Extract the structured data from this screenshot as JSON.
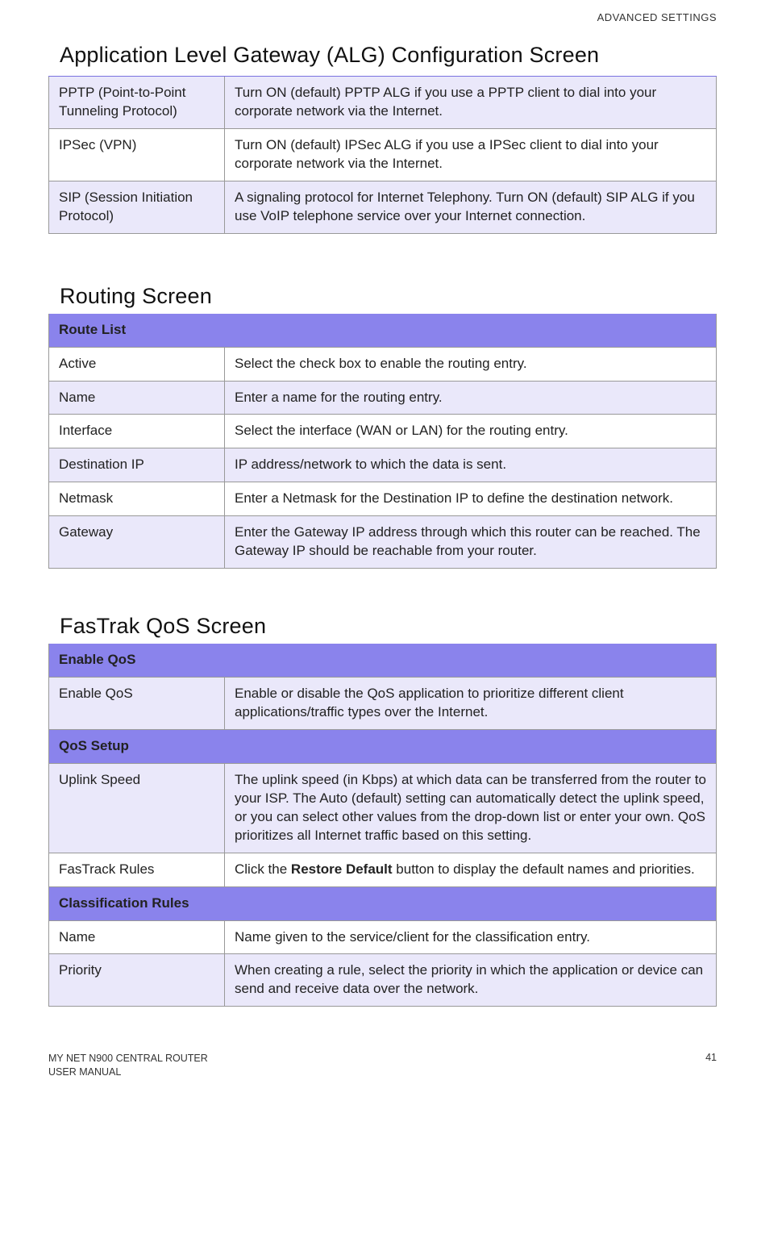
{
  "header": {
    "section": "ADVANCED SETTINGS"
  },
  "alg": {
    "title": "Application Level Gateway (ALG) Configuration Screen",
    "rows": [
      {
        "k": "PPTP (Point-to-Point Tunneling Protocol)",
        "v": "Turn ON (default) PPTP ALG if you use a PPTP client to dial into your corporate network via the Internet."
      },
      {
        "k": "IPSec (VPN)",
        "v": "Turn ON (default) IPSec ALG if you use a IPSec client to dial into your corporate network via the Internet."
      },
      {
        "k": "SIP (Session Initiation Protocol)",
        "v": "A signaling protocol for Internet Telephony. Turn ON (default) SIP ALG if you use VoIP telephone service over your Internet connection."
      }
    ]
  },
  "routing": {
    "title": "Routing Screen",
    "hdr": "Route List",
    "rows": [
      {
        "k": "Active",
        "v": "Select the check box to enable the routing entry."
      },
      {
        "k": "Name",
        "v": "Enter a name for the routing entry."
      },
      {
        "k": "Interface",
        "v": "Select the interface (WAN or LAN) for the routing entry."
      },
      {
        "k": "Destination IP",
        "v": "IP address/network to which the data is sent."
      },
      {
        "k": "Netmask",
        "v": "Enter a Netmask for the Destination IP to define the destination network."
      },
      {
        "k": "Gateway",
        "v": "Enter the Gateway IP address through which this router can be reached. The Gateway IP should be reachable from your router."
      }
    ]
  },
  "qos": {
    "title": "FasTrak QoS Screen",
    "hdr1": "Enable QoS",
    "rows1": [
      {
        "k": "Enable QoS",
        "v": "Enable or disable the QoS application to prioritize different client applications/traffic types over the Internet."
      }
    ],
    "hdr2": "QoS Setup",
    "rows2": [
      {
        "k": "Uplink Speed",
        "v": "The uplink speed (in Kbps) at which data can be transferred from the router to your ISP. The Auto (default) setting can automatically detect the uplink speed, or you can select other values from the drop-down list or enter your own. QoS prioritizes all Internet traffic based on this setting."
      },
      {
        "k": "FasTrack Rules",
        "v_pre": "Click the ",
        "v_bold": "Restore Default",
        "v_post": " button to display the default names and priorities."
      }
    ],
    "hdr3": "Classification Rules",
    "rows3": [
      {
        "k": "Name",
        "v": "Name given to the service/client for the classification entry."
      },
      {
        "k": "Priority",
        "v": "When creating a rule, select the priority in which the application or device can send and receive data over the network."
      }
    ]
  },
  "footer": {
    "line1": "MY NET N900 CENTRAL ROUTER",
    "line2": "USER MANUAL",
    "page": "41"
  }
}
